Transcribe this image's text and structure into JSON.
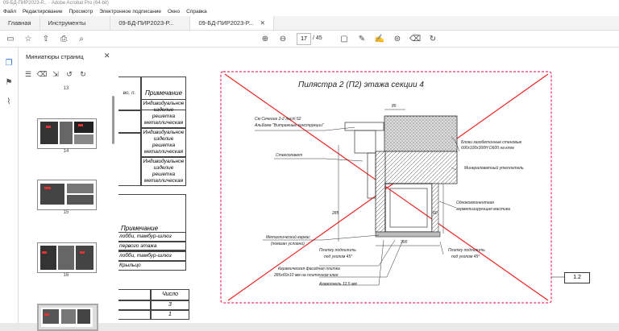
{
  "window": {
    "title": "09-БД-ПИР2023-Р... - Adobe Acrobat Pro (64-bit)"
  },
  "menu": [
    "Файл",
    "Редактирование",
    "Просмотр",
    "Электронное подписание",
    "Окно",
    "Справка"
  ],
  "tabs": [
    {
      "label": "Главная"
    },
    {
      "label": "Инструменты"
    },
    {
      "label": "09-БД-ПИР2023-Р..."
    },
    {
      "label": "09-БД-ПИР2023-Р..."
    }
  ],
  "toolbar": {
    "page_current": "17",
    "page_total": "/ 45"
  },
  "panel": {
    "title": "Миниатюры страниц",
    "thumbnails": [
      {
        "label": "13"
      },
      {
        "label": "14"
      },
      {
        "label": "15"
      },
      {
        "label": "16"
      }
    ]
  },
  "table_left": {
    "header_col1": "во, п.",
    "header_note": "Примечание",
    "notes": [
      "Индивидуальное изделие решетка металлическая",
      "Индивидуальное изделие решетка металлическая",
      "Индивидуальное изделие решетка металлическая"
    ],
    "section_note": "Примечание",
    "rows": [
      "лобби, тамбур-шлюз",
      "первого этажа",
      "лобби, тамбур-шлюз",
      "Крыльцо"
    ],
    "number_header": "Число",
    "numbers": [
      "3",
      "1"
    ]
  },
  "drawing": {
    "title": "Пилястра 2 (П2) этажа секции 4",
    "annotations": [
      "См Сечение 2-2 лист 52",
      "Альбома \"Витражные конструкции\"",
      "Стеклопакет",
      "Блоки газобетонные стеновые",
      "600x100x300H D600 на клее",
      "Минераловатный утеплитель",
      "Однокомпонентная",
      "герметизирующая мастика",
      "Металлический каркас",
      "(показан условно)",
      "Плитку подпилить",
      "под уголом 45°",
      "Плитку подпилить",
      "под уголом 45°",
      "Керамическая фасадная плитка",
      "285x60x10 мм на плиточном клее",
      "Ахваплнель 12,5 мм"
    ],
    "dims": [
      "85",
      "285",
      "300",
      "60"
    ],
    "tag": "1.2"
  }
}
